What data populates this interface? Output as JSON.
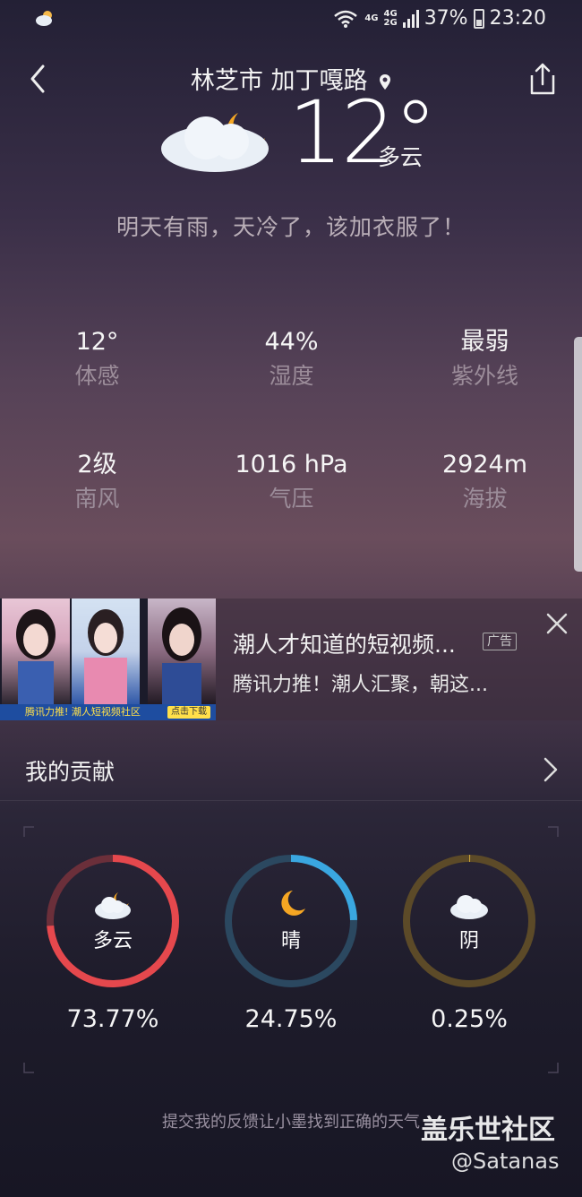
{
  "status_bar": {
    "net_top": "4G",
    "net_mid": "4G",
    "net_bot": "2G",
    "battery": "37%",
    "time": "23:20"
  },
  "header": {
    "title": "林芝市 加丁嘎路"
  },
  "current": {
    "temperature": "12°",
    "condition": "多云",
    "tip": "明天有雨，天冷了，该加衣服了！"
  },
  "details": [
    {
      "value": "12°",
      "label": "体感"
    },
    {
      "value": "44%",
      "label": "湿度"
    },
    {
      "value": "最弱",
      "label": "紫外线"
    },
    {
      "value": "2级",
      "label": "南风"
    },
    {
      "value": "1016 hPa",
      "label": "气压"
    },
    {
      "value": "2924m",
      "label": "海拔"
    }
  ],
  "ad": {
    "title": "潮人才知道的短视频...",
    "tag": "广告",
    "subtitle": "腾讯力推！潮人汇聚，朝这...",
    "strip_text": "腾讯力推! 潮人短视频社区",
    "strip_button": "点击下载"
  },
  "contrib": {
    "label": "我的贡献",
    "items": [
      {
        "name": "多云",
        "percent": "73.77%",
        "fraction": 0.7377,
        "color": "#e5484d",
        "track": "#6b2f3a",
        "icon": "cloud-moon-icon"
      },
      {
        "name": "晴",
        "percent": "24.75%",
        "fraction": 0.2475,
        "color": "#3aa7e0",
        "track": "#2b4860",
        "icon": "moon-icon"
      },
      {
        "name": "阴",
        "percent": "0.25%",
        "fraction": 0.0025,
        "color": "#c8a23c",
        "track": "#5c4a28",
        "icon": "cloud-icon"
      }
    ]
  },
  "footer": {
    "feedback": "提交我的反馈让小墨找到正确的天气",
    "watermark": "盖乐世社区",
    "watermark_user": "@Satanas"
  }
}
